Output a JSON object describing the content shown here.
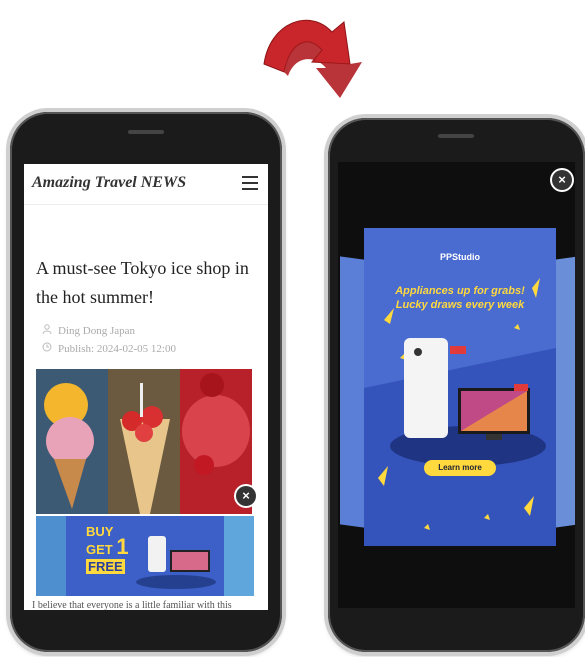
{
  "left_phone": {
    "site_title": "Amazing Travel NEWS",
    "headline": "A must-see Tokyo ice shop in the hot summer!",
    "author": "Ding Dong Japan",
    "publish": "Publish: 2024-02-05 12:00",
    "banner_ad": {
      "line1": "BUY",
      "line2": "GET",
      "number": "1",
      "line3": "FREE"
    },
    "close_label": "×",
    "body_text": "I believe that everyone is a little familiar with this"
  },
  "right_phone": {
    "close_label": "×",
    "promo": {
      "brand": "PPStudio",
      "headline_line1": "Appliances up for grabs!",
      "headline_line2": "Lucky draws every week",
      "cta": "Learn more"
    }
  },
  "colors": {
    "arrow": "#c8262a",
    "promo_bg": "#3d5fc8",
    "accent_yellow": "#ffd93d",
    "phone_frame": "#1b1b1b"
  }
}
